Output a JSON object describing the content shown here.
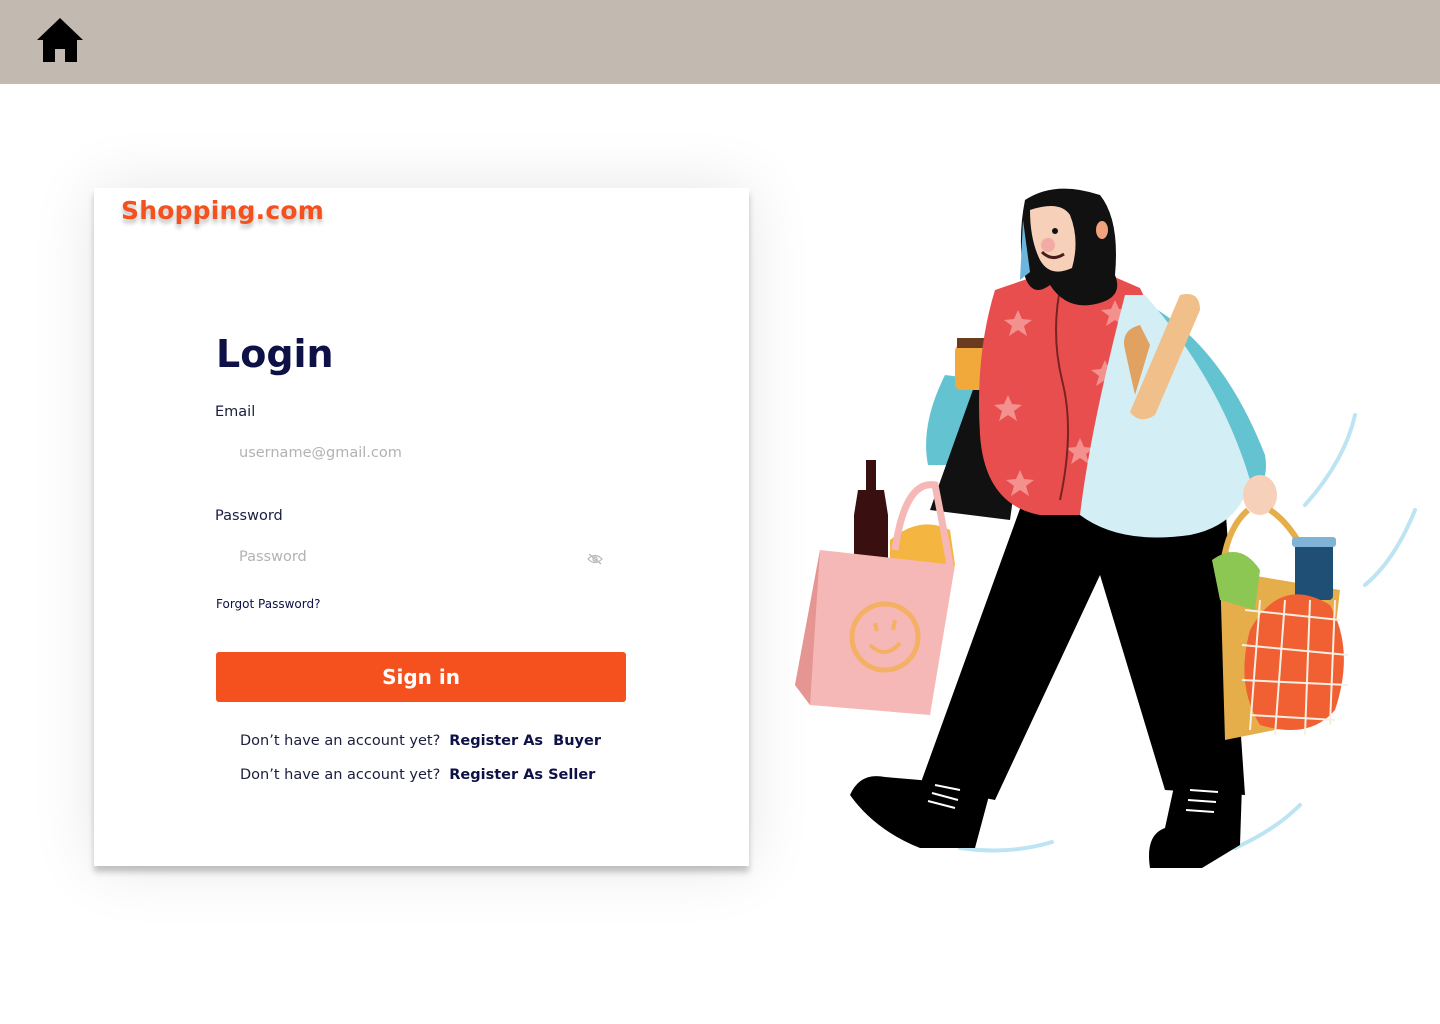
{
  "header": {
    "home_icon": "home-icon"
  },
  "brand": {
    "name": "Shopping.com",
    "color": "#f4511e"
  },
  "login": {
    "title": "Login",
    "email_label": "Email",
    "email_placeholder": "username@gmail.com",
    "password_label": "Password",
    "password_placeholder": "Password",
    "password_toggle_icon": "eye-slash-icon",
    "forgot_password": "Forgot Password?",
    "signin_label": "Sign in"
  },
  "register": [
    {
      "prompt": "Don’t have an account yet?",
      "link": "Register As  Buyer"
    },
    {
      "prompt": "Don’t have an account yet?",
      "link": "Register As Seller"
    }
  ],
  "colors": {
    "accent": "#f4511e",
    "header_bg": "#c2bab0",
    "title": "#0d1146"
  },
  "illustration": {
    "icon": "woman-with-shopping-bags-illustration"
  }
}
